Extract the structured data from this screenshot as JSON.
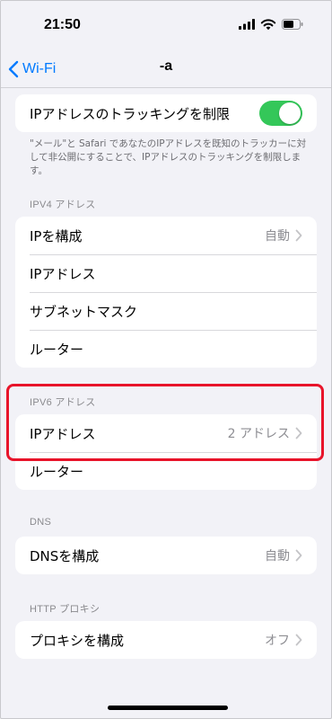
{
  "status_bar": {
    "time": "21:50"
  },
  "nav": {
    "back_label": "Wi-Fi",
    "title": "-a"
  },
  "tracking": {
    "label": "IPアドレスのトラッキングを制限",
    "toggle_on": true,
    "footnote": "\"メール\"と Safari であなたのIPアドレスを既知のトラッカーに対して非公開にすることで、IPアドレスのトラッキングを制限します。"
  },
  "ipv4": {
    "header": "IPV4 アドレス",
    "rows": [
      {
        "label": "IPを構成",
        "value": "自動"
      },
      {
        "label": "IPアドレス"
      },
      {
        "label": "サブネットマスク"
      },
      {
        "label": "ルーター"
      }
    ]
  },
  "ipv6": {
    "header": "IPV6 アドレス",
    "rows": [
      {
        "label": "IPアドレス",
        "value": "2 アドレス"
      },
      {
        "label": "ルーター"
      }
    ]
  },
  "dns": {
    "header": "DNS",
    "rows": [
      {
        "label": "DNSを構成",
        "value": "自動"
      }
    ]
  },
  "proxy": {
    "header": "HTTP プロキシ",
    "rows": [
      {
        "label": "プロキシを構成",
        "value": "オフ"
      }
    ]
  },
  "colors": {
    "accent": "#007aff",
    "toggle_on": "#34c759",
    "highlight": "#e8142a"
  }
}
